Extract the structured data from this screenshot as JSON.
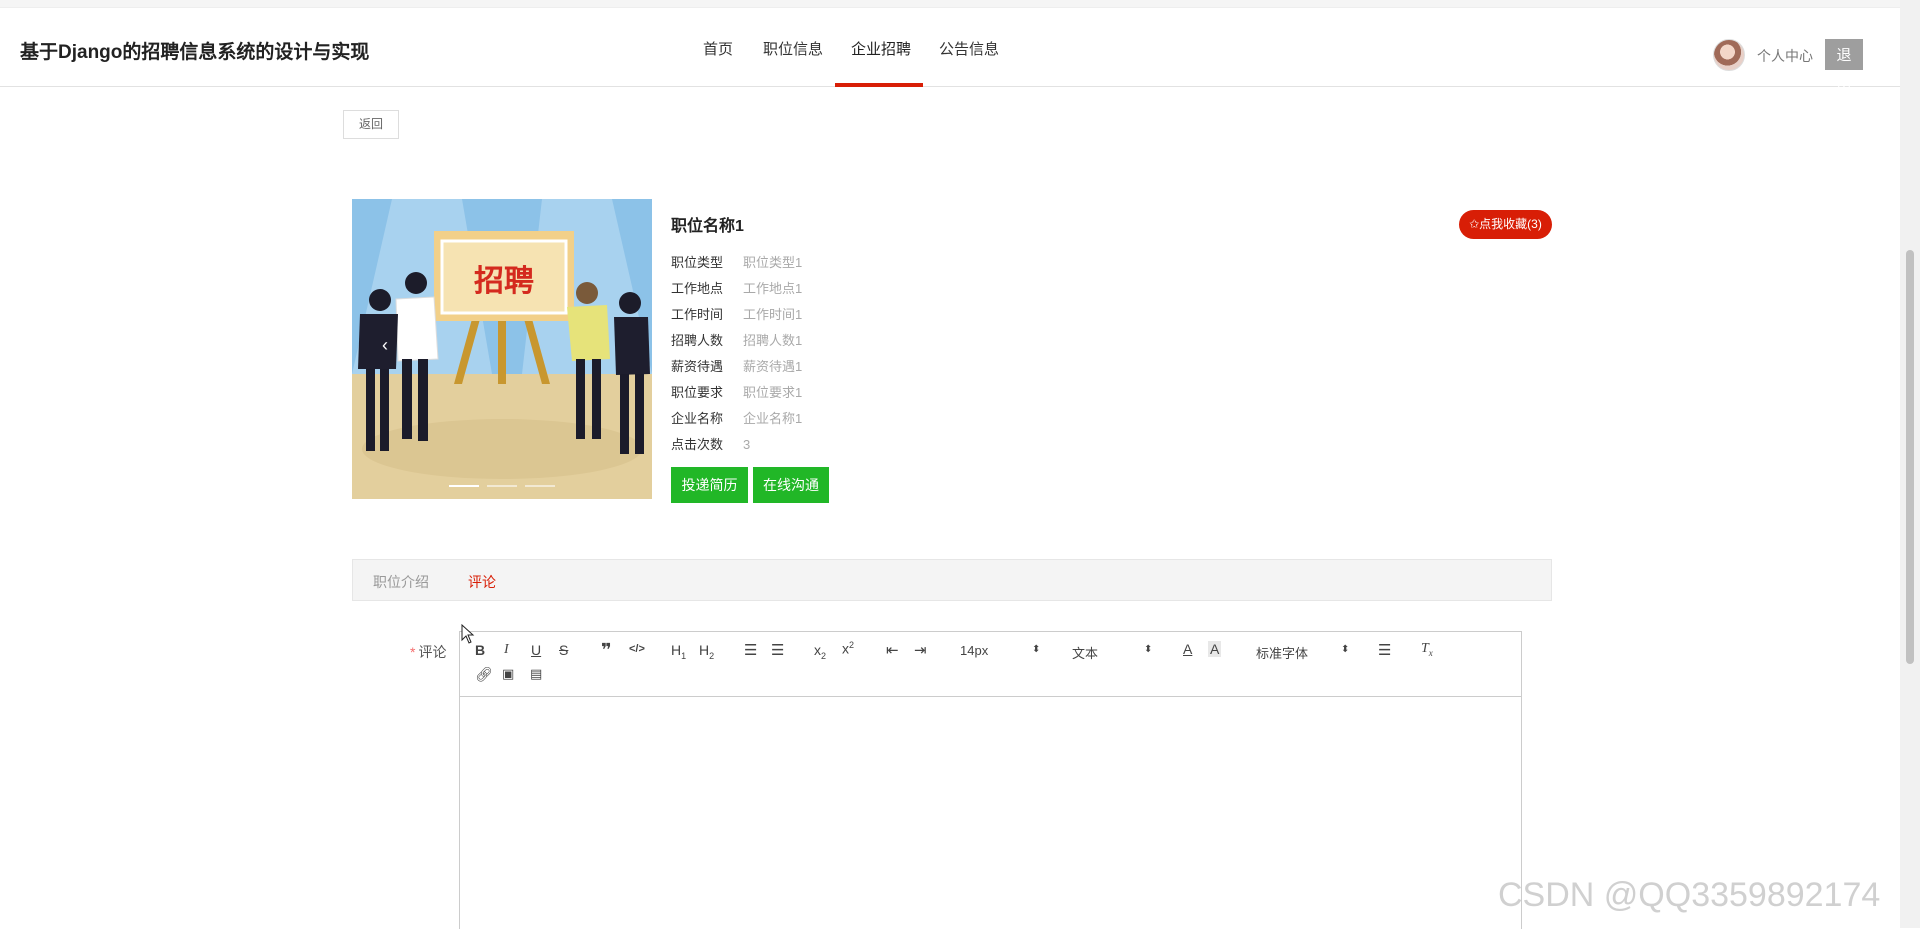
{
  "header": {
    "title": "基于Django的招聘信息系统的设计与实现",
    "nav": [
      "首页",
      "职位信息",
      "企业招聘",
      "公告信息"
    ],
    "active_nav": "企业招聘",
    "user_center": "个人中心",
    "logout": "退出"
  },
  "back_label": "返回",
  "poster": {
    "sign_text": "招聘",
    "prev_glyph": "‹"
  },
  "job": {
    "title": "职位名称1",
    "favorite_label": "✩点我收藏(3)",
    "fields": [
      {
        "label": "职位类型",
        "value": "职位类型1"
      },
      {
        "label": "工作地点",
        "value": "工作地点1"
      },
      {
        "label": "工作时间",
        "value": "工作时间1"
      },
      {
        "label": "招聘人数",
        "value": "招聘人数1"
      },
      {
        "label": "薪资待遇",
        "value": "薪资待遇1"
      },
      {
        "label": "职位要求",
        "value": "职位要求1"
      },
      {
        "label": "企业名称",
        "value": "企业名称1"
      },
      {
        "label": "点击次数",
        "value": "3"
      }
    ],
    "apply_label": "投递简历",
    "chat_label": "在线沟通"
  },
  "tabs": [
    "职位介绍",
    "评论"
  ],
  "active_tab": "评论",
  "comment": {
    "required_mark": "*",
    "label": "评论",
    "toolbar": {
      "size": "14px",
      "header": "文本",
      "font": "标准字体"
    }
  },
  "watermark": "CSDN @QQ3359892174",
  "colors": {
    "accent_red": "#d81e06",
    "action_green": "#21b727",
    "tab_active": "#d81e06"
  }
}
